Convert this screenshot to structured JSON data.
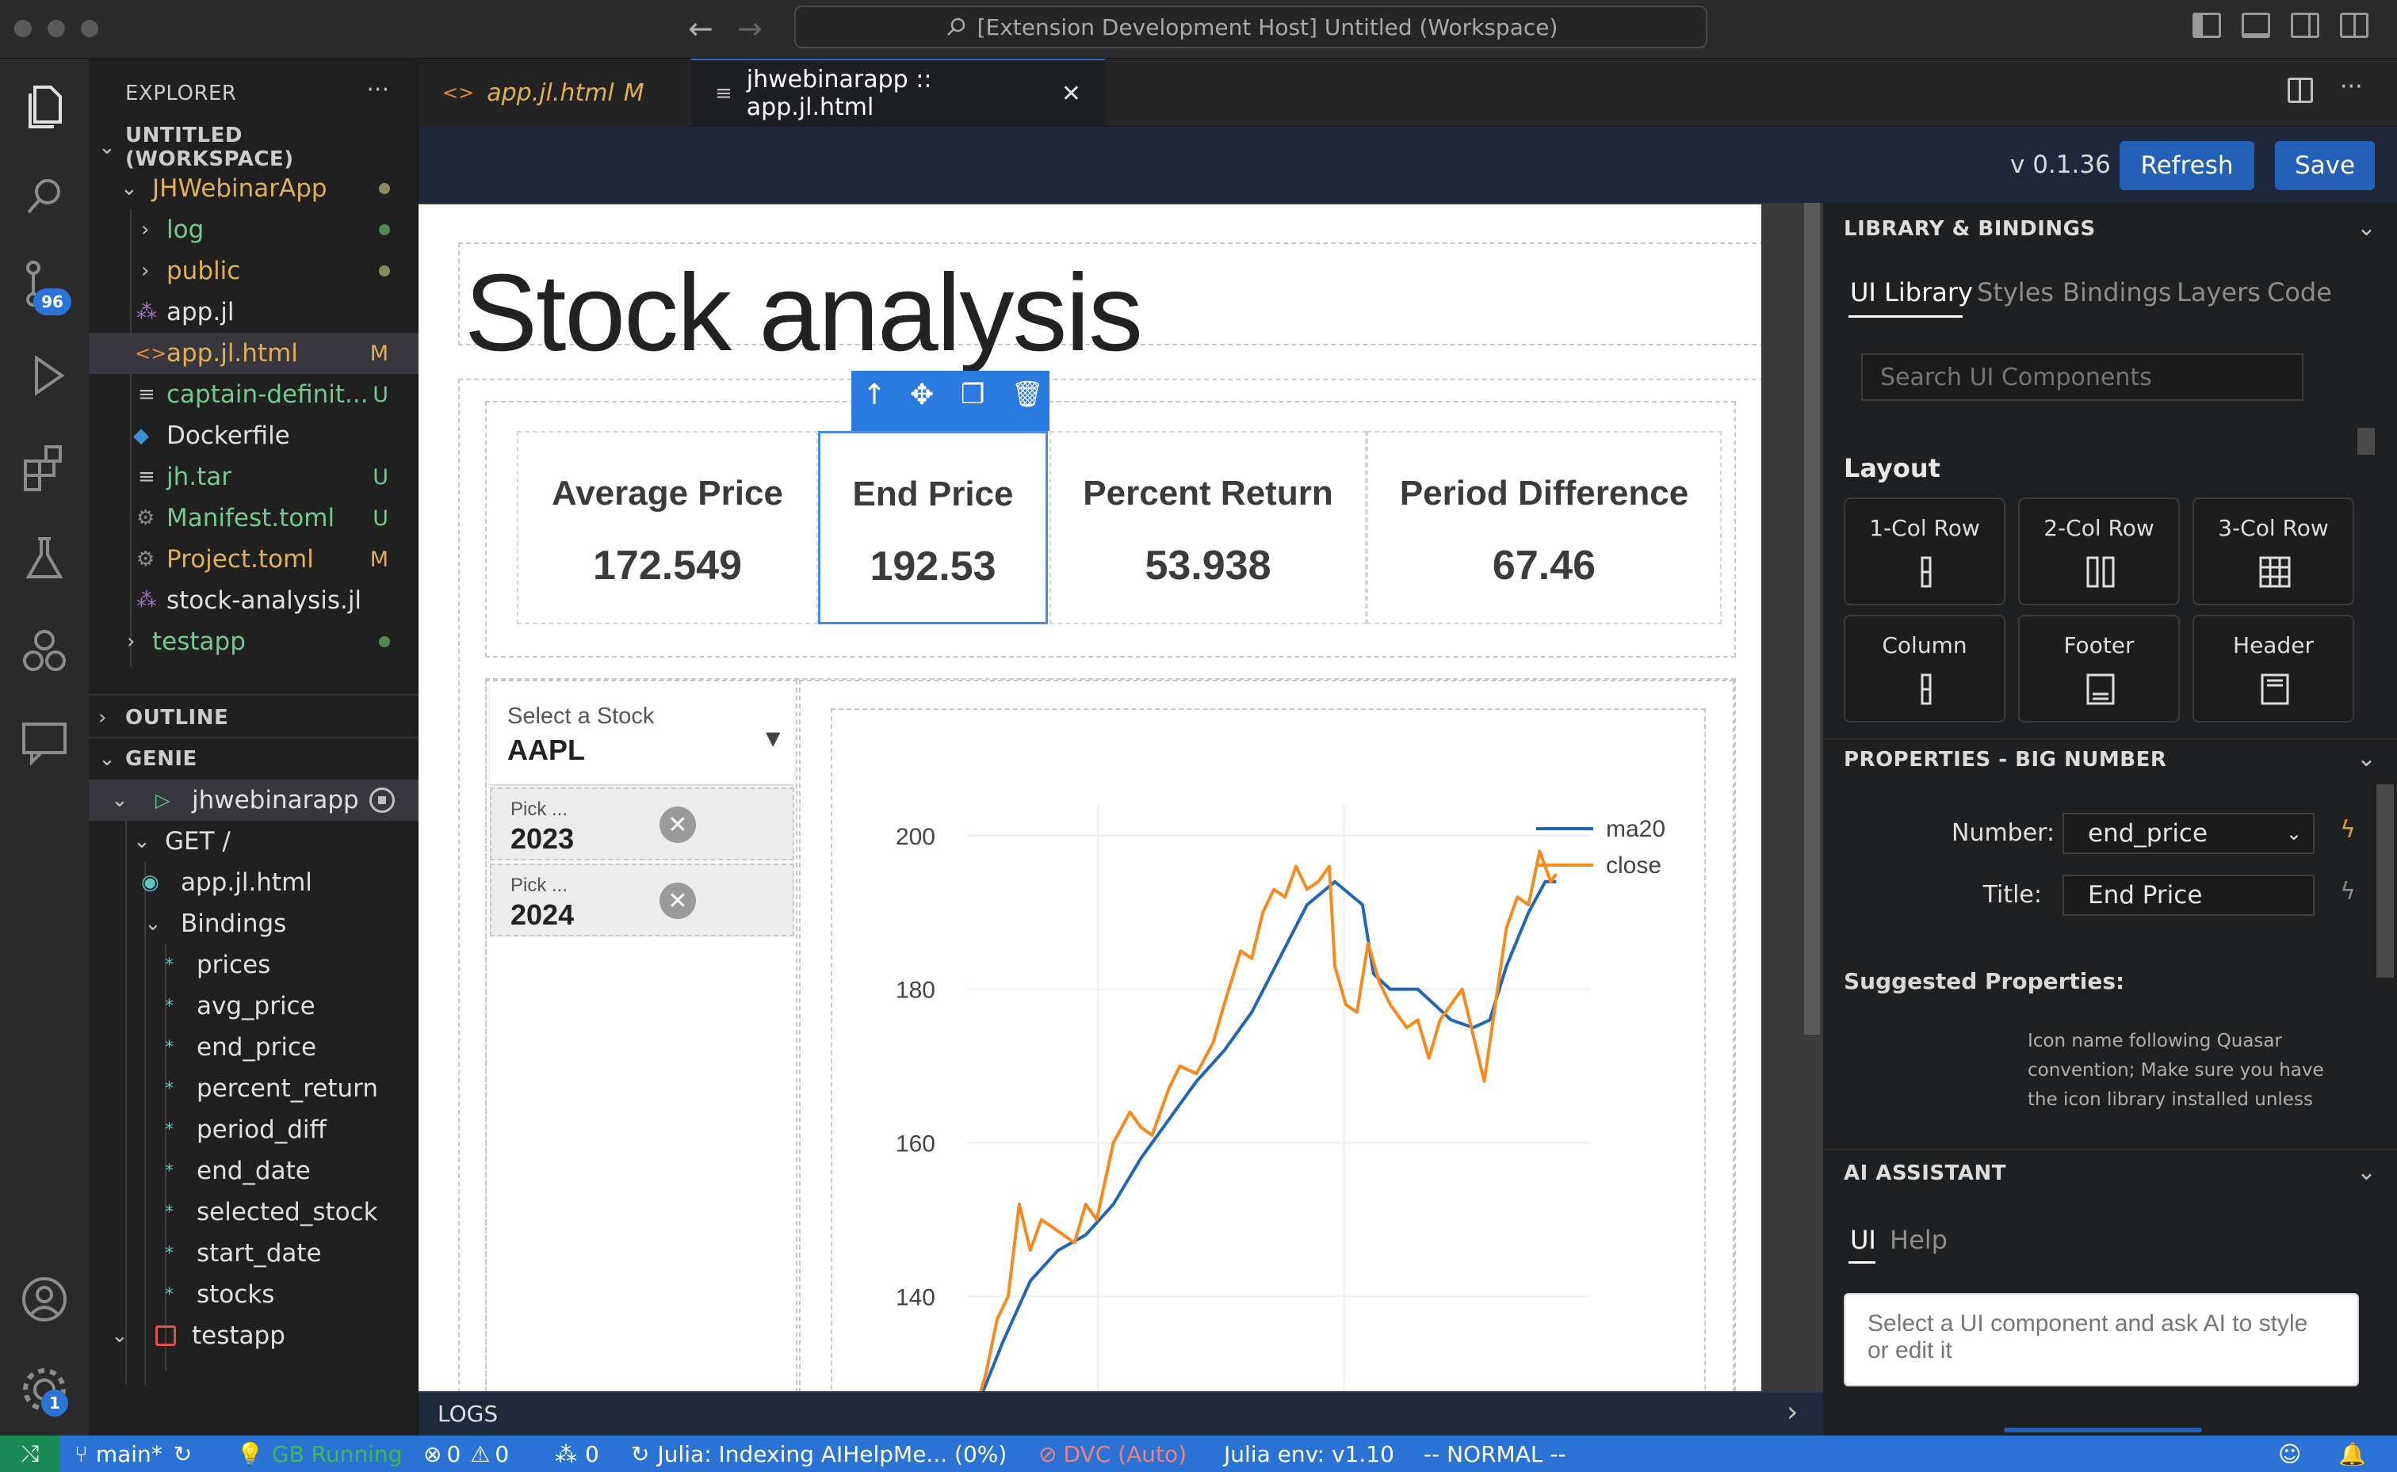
{
  "titlebar": {
    "title": "[Extension Development Host] Untitled (Workspace)"
  },
  "activity": {
    "scm_badge": "96",
    "settings_badge": "1"
  },
  "explorer": {
    "header": "EXPLORER",
    "workspace": "UNTITLED (WORKSPACE)",
    "folder": "JHWebinarApp",
    "items": [
      {
        "label": "log",
        "status": ""
      },
      {
        "label": "public",
        "status": ""
      },
      {
        "label": "app.jl",
        "status": ""
      },
      {
        "label": "app.jl.html",
        "status": "M"
      },
      {
        "label": "captain-definit...",
        "status": "U"
      },
      {
        "label": "Dockerfile",
        "status": ""
      },
      {
        "label": "jh.tar",
        "status": "U"
      },
      {
        "label": "Manifest.toml",
        "status": "U"
      },
      {
        "label": "Project.toml",
        "status": "M"
      },
      {
        "label": "stock-analysis.jl",
        "status": ""
      },
      {
        "label": "testapp",
        "status": ""
      }
    ],
    "outline": "OUTLINE",
    "genie": "GENIE",
    "genie_app": "jhwebinarapp",
    "route": "GET /",
    "route_file": "app.jl.html",
    "bindings_label": "Bindings",
    "bindings": [
      "prices",
      "avg_price",
      "end_price",
      "percent_return",
      "period_diff",
      "end_date",
      "selected_stock",
      "start_date",
      "stocks"
    ],
    "genie_app2": "testapp"
  },
  "tabs": [
    {
      "label": "app.jl.html",
      "status": "M"
    },
    {
      "label": "jhwebinarapp :: app.jl.html"
    }
  ],
  "builder": {
    "version": "v 0.1.36",
    "refresh": "Refresh",
    "save": "Save",
    "heading": "Stock analysis",
    "cards": [
      {
        "title": "Average Price",
        "value": "172.549"
      },
      {
        "title": "End Price",
        "value": "192.53"
      },
      {
        "title": "Percent Return",
        "value": "53.938"
      },
      {
        "title": "Period Difference",
        "value": "67.46"
      }
    ],
    "select_label": "Select a Stock",
    "select_value": "AAPL",
    "date1_label": "Pick ...",
    "date1_value": "2023",
    "date2_label": "Pick ...",
    "date2_value": "2024"
  },
  "chart_data": {
    "type": "line",
    "yticks": [
      140,
      160,
      180,
      200
    ],
    "ylim": [
      126,
      204
    ],
    "xlim": [
      0,
      1
    ],
    "series": [
      {
        "name": "ma20",
        "color": "#1f66b5",
        "points": [
          [
            0.0,
            125
          ],
          [
            0.05,
            134
          ],
          [
            0.1,
            142
          ],
          [
            0.15,
            146
          ],
          [
            0.2,
            148
          ],
          [
            0.25,
            152
          ],
          [
            0.3,
            158
          ],
          [
            0.35,
            163
          ],
          [
            0.4,
            168
          ],
          [
            0.45,
            172
          ],
          [
            0.5,
            177
          ],
          [
            0.55,
            184
          ],
          [
            0.6,
            191
          ],
          [
            0.65,
            194
          ],
          [
            0.7,
            191
          ],
          [
            0.72,
            182
          ],
          [
            0.75,
            180
          ],
          [
            0.8,
            180
          ],
          [
            0.83,
            178
          ],
          [
            0.86,
            176
          ],
          [
            0.9,
            175
          ],
          [
            0.93,
            176
          ],
          [
            0.96,
            183
          ],
          [
            1.0,
            190
          ],
          [
            1.03,
            194
          ],
          [
            1.05,
            194
          ]
        ]
      },
      {
        "name": "close",
        "color": "#f58a1f",
        "points": [
          [
            0.0,
            125
          ],
          [
            0.02,
            130
          ],
          [
            0.04,
            137
          ],
          [
            0.06,
            140
          ],
          [
            0.08,
            152
          ],
          [
            0.1,
            146
          ],
          [
            0.12,
            150
          ],
          [
            0.14,
            149
          ],
          [
            0.16,
            148
          ],
          [
            0.18,
            147
          ],
          [
            0.2,
            152
          ],
          [
            0.22,
            150
          ],
          [
            0.25,
            160
          ],
          [
            0.28,
            164
          ],
          [
            0.3,
            162
          ],
          [
            0.32,
            161
          ],
          [
            0.35,
            167
          ],
          [
            0.37,
            170
          ],
          [
            0.4,
            169
          ],
          [
            0.43,
            173
          ],
          [
            0.45,
            178
          ],
          [
            0.48,
            185
          ],
          [
            0.5,
            184
          ],
          [
            0.52,
            190
          ],
          [
            0.54,
            193
          ],
          [
            0.56,
            192
          ],
          [
            0.58,
            196
          ],
          [
            0.6,
            193
          ],
          [
            0.62,
            194
          ],
          [
            0.64,
            196
          ],
          [
            0.65,
            183
          ],
          [
            0.67,
            178
          ],
          [
            0.69,
            177
          ],
          [
            0.71,
            186
          ],
          [
            0.73,
            181
          ],
          [
            0.75,
            178
          ],
          [
            0.78,
            175
          ],
          [
            0.8,
            176
          ],
          [
            0.82,
            171
          ],
          [
            0.84,
            176
          ],
          [
            0.86,
            178
          ],
          [
            0.88,
            180
          ],
          [
            0.9,
            174
          ],
          [
            0.92,
            168
          ],
          [
            0.94,
            178
          ],
          [
            0.96,
            188
          ],
          [
            0.98,
            192
          ],
          [
            1.0,
            191
          ],
          [
            1.02,
            198
          ],
          [
            1.04,
            194
          ],
          [
            1.05,
            195
          ]
        ]
      }
    ]
  },
  "right_panel": {
    "lib_header": "LIBRARY & BINDINGS",
    "tabs": [
      "UI Library",
      "Styles",
      "Bindings",
      "Layers",
      "Code"
    ],
    "search_placeholder": "Search UI Components",
    "layout_label": "Layout",
    "layout_items": [
      "1-Col Row",
      "2-Col Row",
      "3-Col Row",
      "Column",
      "Footer",
      "Header"
    ],
    "props_header": "PROPERTIES - BIG NUMBER",
    "number_label": "Number:",
    "number_value": "end_price",
    "title_label": "Title:",
    "title_value": "End Price",
    "suggested_label": "Suggested Properties:",
    "suggested_text": "Icon name following Quasar convention; Make sure you have the icon library installed unless you are using 'img:'",
    "ai_header": "AI ASSISTANT",
    "ai_tabs": [
      "UI",
      "Help"
    ],
    "ai_placeholder": "Select a UI component and ask AI to style or edit it"
  },
  "logs": {
    "label": "LOGS"
  },
  "statusbar": {
    "branch": "main*",
    "gb_running": "GB Running",
    "errors": "0",
    "warnings": "0",
    "ports": "0",
    "julia_indexing": "Julia: Indexing AIHelpMe... (0%)",
    "dvc": "DVC (Auto)",
    "julia_env": "Julia env: v1.10",
    "mode": "-- NORMAL --"
  }
}
